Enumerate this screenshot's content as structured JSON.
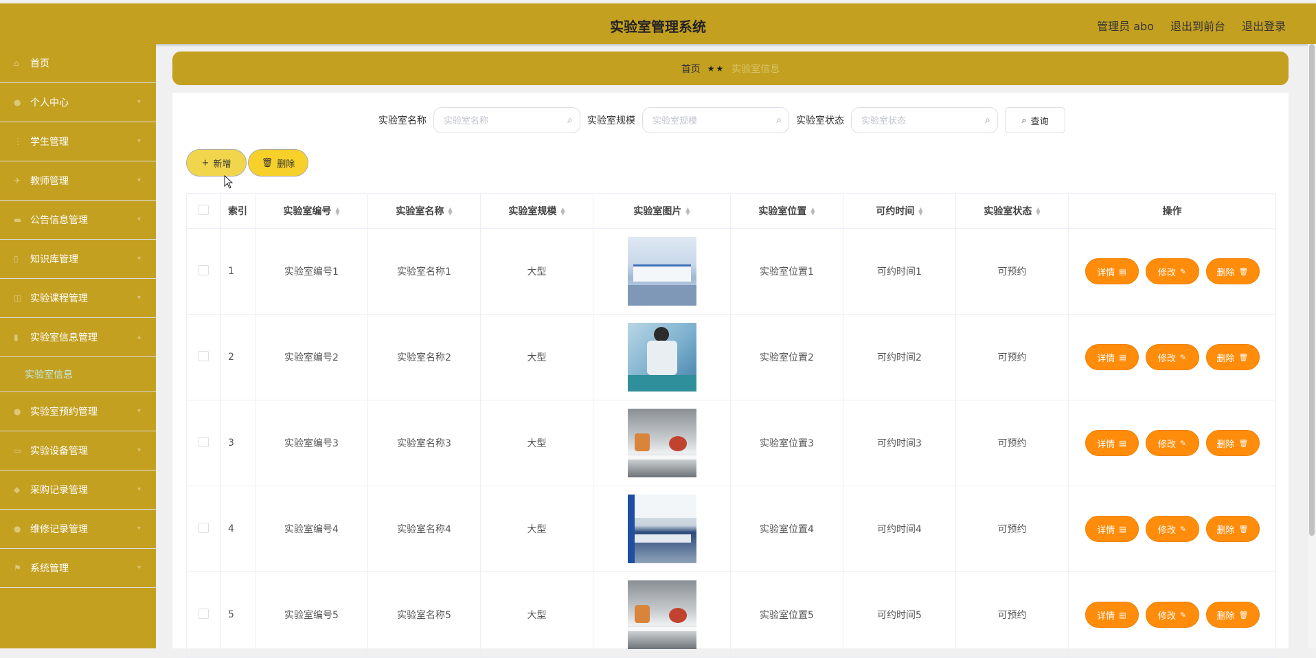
{
  "header": {
    "title": "实验室管理系统",
    "admin_label": "管理员 abo",
    "to_front": "退出到前台",
    "logout": "退出登录"
  },
  "sidebar": {
    "items": [
      {
        "label": "首页",
        "icon": "home-icon"
      },
      {
        "label": "个人中心",
        "icon": "user-icon"
      },
      {
        "label": "学生管理",
        "icon": "student-icon"
      },
      {
        "label": "教师管理",
        "icon": "teacher-icon"
      },
      {
        "label": "公告信息管理",
        "icon": "notice-icon"
      },
      {
        "label": "知识库管理",
        "icon": "book-icon"
      },
      {
        "label": "实验课程管理",
        "icon": "course-icon"
      },
      {
        "label": "实验室信息管理",
        "icon": "chart-icon"
      },
      {
        "label": "实验室预约管理",
        "icon": "user-icon"
      },
      {
        "label": "实验设备管理",
        "icon": "device-icon"
      },
      {
        "label": "采购记录管理",
        "icon": "purchase-icon"
      },
      {
        "label": "维修记录管理",
        "icon": "user-icon"
      },
      {
        "label": "系统管理",
        "icon": "flag-icon"
      }
    ],
    "active_sub": "实验室信息"
  },
  "breadcrumb": {
    "home": "首页",
    "sep": "★★",
    "current": "实验室信息"
  },
  "search": {
    "name_label": "实验室名称",
    "name_placeholder": "实验室名称",
    "scale_label": "实验室规模",
    "scale_placeholder": "实验室规模",
    "status_label": "实验室状态",
    "status_placeholder": "实验室状态",
    "query_label": "查询"
  },
  "actions": {
    "add_label": "新增",
    "delete_label": "删除"
  },
  "table": {
    "columns": [
      "索引",
      "实验室编号",
      "实验室名称",
      "实验室规模",
      "实验室图片",
      "实验室位置",
      "可约时间",
      "实验室状态",
      "操作"
    ],
    "rows": [
      {
        "index": "1",
        "code": "实验室编号1",
        "name": "实验室名称1",
        "scale": "大型",
        "location": "实验室位置1",
        "time": "可约时间1",
        "status": "可预约"
      },
      {
        "index": "2",
        "code": "实验室编号2",
        "name": "实验室名称2",
        "scale": "大型",
        "location": "实验室位置2",
        "time": "可约时间2",
        "status": "可预约"
      },
      {
        "index": "3",
        "code": "实验室编号3",
        "name": "实验室名称3",
        "scale": "大型",
        "location": "实验室位置3",
        "time": "可约时间3",
        "status": "可预约"
      },
      {
        "index": "4",
        "code": "实验室编号4",
        "name": "实验室名称4",
        "scale": "大型",
        "location": "实验室位置4",
        "time": "可约时间4",
        "status": "可预约"
      },
      {
        "index": "5",
        "code": "实验室编号5",
        "name": "实验室名称5",
        "scale": "大型",
        "location": "实验室位置5",
        "time": "可约时间5",
        "status": "可预约"
      }
    ],
    "op_detail": "详情",
    "op_edit": "修改",
    "op_delete": "删除"
  },
  "colors": {
    "brand": "#c4a021",
    "op_button": "#ff8c0a",
    "active_sub": "#bfe9e4"
  }
}
